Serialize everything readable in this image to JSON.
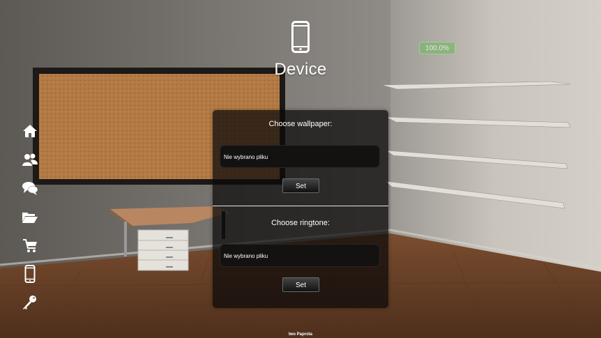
{
  "header": {
    "title": "Device",
    "icon": "smartphone-icon"
  },
  "battery": {
    "label": "100.0%",
    "color": "#86b578"
  },
  "sidebar": {
    "items": [
      {
        "icon": "home-icon"
      },
      {
        "icon": "users-icon"
      },
      {
        "icon": "chat-icon"
      },
      {
        "icon": "folder-open-icon"
      },
      {
        "icon": "shopping-cart-icon"
      },
      {
        "icon": "smartphone-icon"
      },
      {
        "icon": "key-icon"
      }
    ]
  },
  "wallpaper": {
    "label": "Choose wallpaper:",
    "file_status": "Nie wybrano pliku",
    "button": "Set"
  },
  "ringtone": {
    "label": "Choose ringtone:",
    "file_status": "Nie wybrano pliku",
    "button": "Set"
  },
  "footer": {
    "author": "Iwo Paprota"
  },
  "colors": {
    "panel": "rgba(10,8,8,0.72)",
    "text": "#ffffff",
    "cork": "#b47a45",
    "floor": "#6a4026"
  }
}
